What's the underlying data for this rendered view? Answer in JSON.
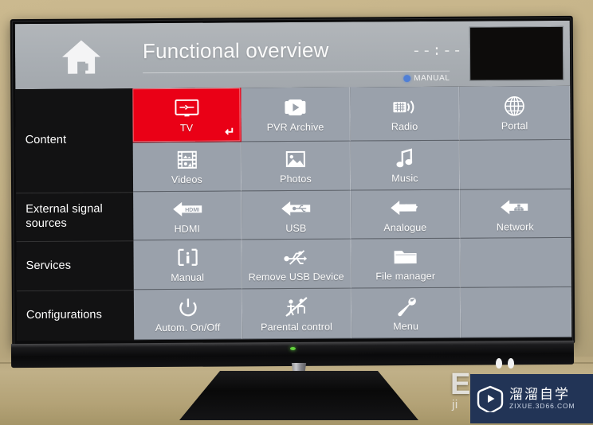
{
  "header": {
    "home_icon": "home-icon",
    "title": "Functional overview",
    "clock": "--:--",
    "mode_indicator": "Manual",
    "thumbnail": "preview-thumbnail"
  },
  "sidebar": {
    "items": [
      {
        "label": "Content"
      },
      {
        "label": "External signal sources"
      },
      {
        "label": "Services"
      },
      {
        "label": "Configurations"
      }
    ]
  },
  "grid": {
    "rows": [
      {
        "section": "Content",
        "tiles": [
          {
            "label": "TV",
            "icon": "tv-icon",
            "selected": true,
            "enter_glyph": "↵"
          },
          {
            "label": "PVR Archive",
            "icon": "pvr-play-icon",
            "selected": false
          },
          {
            "label": "Radio",
            "icon": "radio-icon",
            "selected": false
          },
          {
            "label": "Portal",
            "icon": "globe-icon",
            "selected": false
          }
        ]
      },
      {
        "section": "Content",
        "tiles": [
          {
            "label": "Videos",
            "icon": "film-icon",
            "selected": false
          },
          {
            "label": "Photos",
            "icon": "photo-icon",
            "selected": false
          },
          {
            "label": "Music",
            "icon": "music-note-icon",
            "selected": false
          },
          {
            "label": "",
            "icon": "",
            "empty": true
          }
        ]
      },
      {
        "section": "External signal sources",
        "tiles": [
          {
            "label": "HDMI",
            "icon": "arrow-hdmi-icon",
            "selected": false
          },
          {
            "label": "USB",
            "icon": "arrow-usb-icon",
            "selected": false
          },
          {
            "label": "Analogue",
            "icon": "arrow-analogue-icon",
            "selected": false
          },
          {
            "label": "Network",
            "icon": "arrow-network-icon",
            "selected": false
          }
        ]
      },
      {
        "section": "Services",
        "tiles": [
          {
            "label": "Manual",
            "icon": "info-book-icon",
            "selected": false
          },
          {
            "label": "Remove USB Device",
            "icon": "usb-eject-icon",
            "selected": false
          },
          {
            "label": "File manager",
            "icon": "folder-icon",
            "selected": false
          },
          {
            "label": "",
            "icon": "",
            "empty": true
          }
        ]
      },
      {
        "section": "Configurations",
        "tiles": [
          {
            "label": "Autom. On/Off",
            "icon": "power-icon",
            "selected": false
          },
          {
            "label": "Parental control",
            "icon": "parental-control-icon",
            "selected": false
          },
          {
            "label": "Menu",
            "icon": "wrench-icon",
            "selected": false
          },
          {
            "label": "",
            "icon": "",
            "empty": true
          }
        ]
      }
    ]
  },
  "colors": {
    "selected_tile": "#ea0016",
    "tile": "#9aa1ab",
    "header": "#a9aeb3",
    "sidebar": "#121213",
    "led": "#62d23c",
    "manual_dot": "#4f7fd6",
    "watermark_bg": "#223456"
  },
  "watermark": {
    "brand_cn": "溜溜自学",
    "url": "ZIXUE.3D66.COM",
    "logo": "play-button-logo",
    "background_letter": "E",
    "background_sub": "ji"
  }
}
